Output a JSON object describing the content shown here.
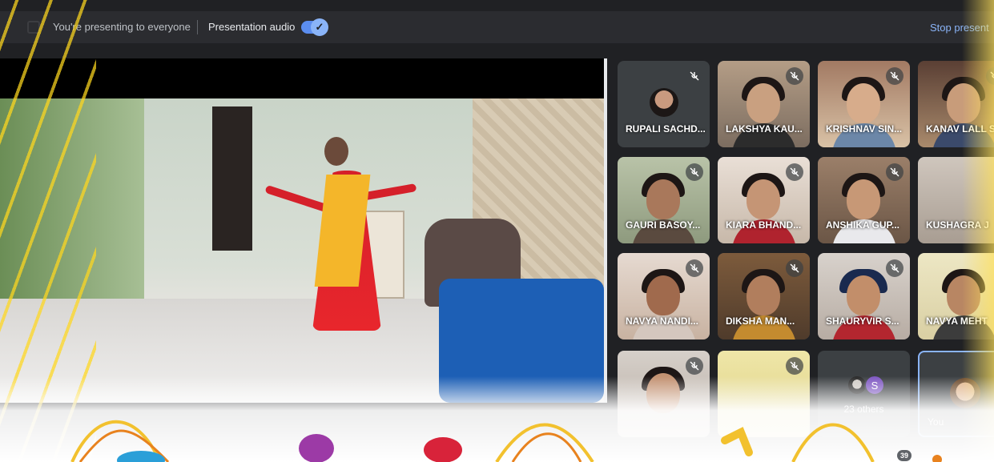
{
  "topbar": {
    "presenting_text": "You're presenting to everyone",
    "audio_label": "Presentation audio",
    "stop_label": "Stop present",
    "audio_on": true
  },
  "participants": [
    {
      "name": "RUPALI SACHD...",
      "muted": true
    },
    {
      "name": "LAKSHYA KAU...",
      "muted": true
    },
    {
      "name": "KRISHNAV SIN...",
      "muted": true
    },
    {
      "name": "KANAV LALL S",
      "muted": true
    },
    {
      "name": "GAURI BASOY...",
      "muted": true
    },
    {
      "name": "KIARA BHAND...",
      "muted": true
    },
    {
      "name": "ANSHIKA GUP...",
      "muted": true
    },
    {
      "name": "KUSHAGRA J",
      "muted": false
    },
    {
      "name": "NAVYA NANDI...",
      "muted": true
    },
    {
      "name": "DIKSHA MAN...",
      "muted": true
    },
    {
      "name": "SHAURYVIR S...",
      "muted": true
    },
    {
      "name": "NAVYA MEHT",
      "muted": false
    },
    {
      "name": "",
      "muted": true
    },
    {
      "name": "",
      "muted": true
    }
  ],
  "others": {
    "label": "23 others",
    "avatar_letter": "S"
  },
  "self_tile": {
    "label": "You"
  },
  "participant_count": "39",
  "colors": {
    "accent": "#8ab4f8",
    "toggle": "#5b8def",
    "background": "#202124",
    "tile": "#3c4043"
  }
}
